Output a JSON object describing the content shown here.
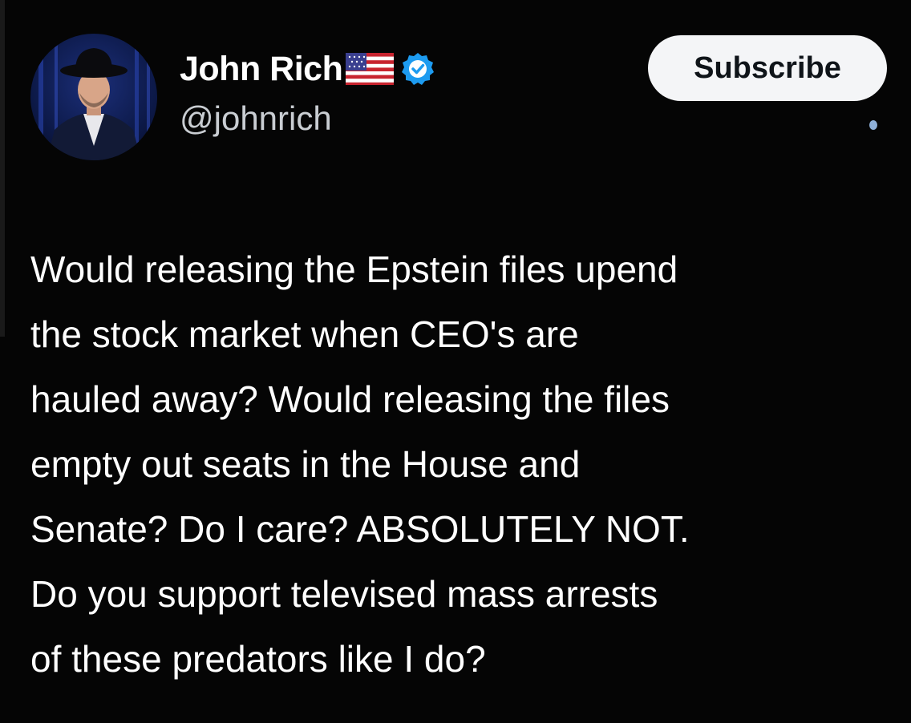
{
  "author": {
    "display_name": "John Rich",
    "handle": "@johnrich",
    "flag_icon": "us-flag-icon",
    "verified_icon": "verified-badge-icon",
    "verified_color": "#1d9bf0"
  },
  "header": {
    "subscribe_label": "Subscribe"
  },
  "tweet": {
    "text": "Would releasing the Epstein files upend\nthe stock market when CEO's are\nhauled away? Would releasing the files\nempty out seats in the House and\nSenate? Do I care? ABSOLUTELY NOT.\nDo you support televised mass arrests\nof these predators like I do?"
  },
  "theme": {
    "background": "#000000",
    "text": "#ffffff",
    "muted_text": "#c9cdd2",
    "button_bg": "#f4f5f7",
    "button_text": "#0f1419"
  }
}
